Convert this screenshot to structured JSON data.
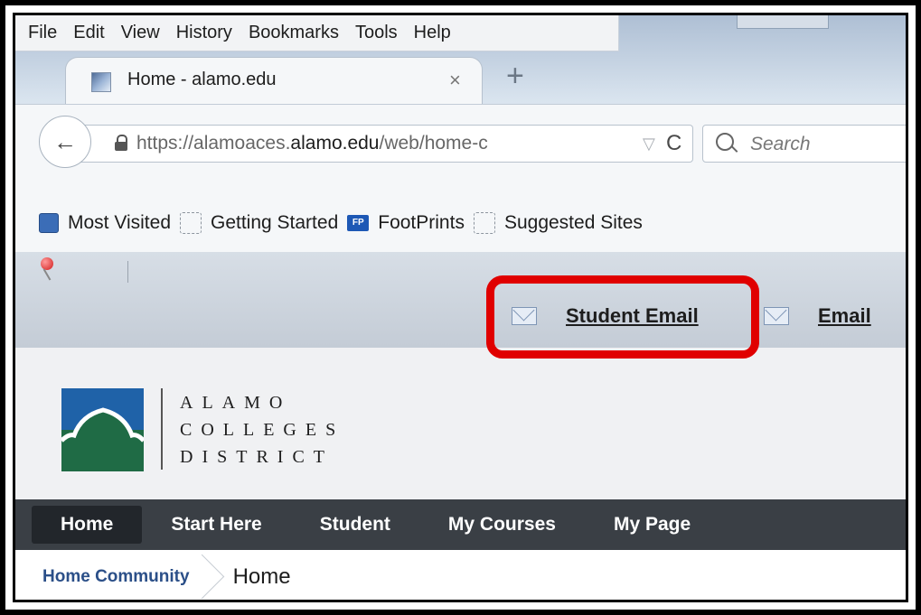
{
  "menu": [
    "File",
    "Edit",
    "View",
    "History",
    "Bookmarks",
    "Tools",
    "Help"
  ],
  "tab": {
    "title": "Home - alamo.edu",
    "close": "×",
    "new_tab": "+"
  },
  "navbar": {
    "url_prefix": "https://alamoaces.",
    "url_domain": "alamo.edu",
    "url_suffix": "/web/home-c",
    "search_placeholder": "Search",
    "back": "←",
    "reload": "C",
    "dropdown": "▽"
  },
  "bookmarks": [
    "Most Visited",
    "Getting Started",
    "FootPrints",
    "Suggested Sites"
  ],
  "bookmark_fp_badge": "FP",
  "portal_toolbar": {
    "student_email": "Student Email",
    "email": "Email"
  },
  "logo": {
    "line1": "ALAMO",
    "line2": "COLLEGES",
    "line3": "DISTRICT",
    "colors": {
      "blue": "#1f62a8",
      "green": "#1f6b45"
    }
  },
  "main_nav": [
    "Home",
    "Start Here",
    "Student",
    "My Courses",
    "My Page"
  ],
  "breadcrumb": {
    "link": "Home Community",
    "current": "Home"
  },
  "colors": {
    "highlight": "#e00000",
    "nav_bg": "#3a3f45",
    "link": "#2b4f88"
  }
}
